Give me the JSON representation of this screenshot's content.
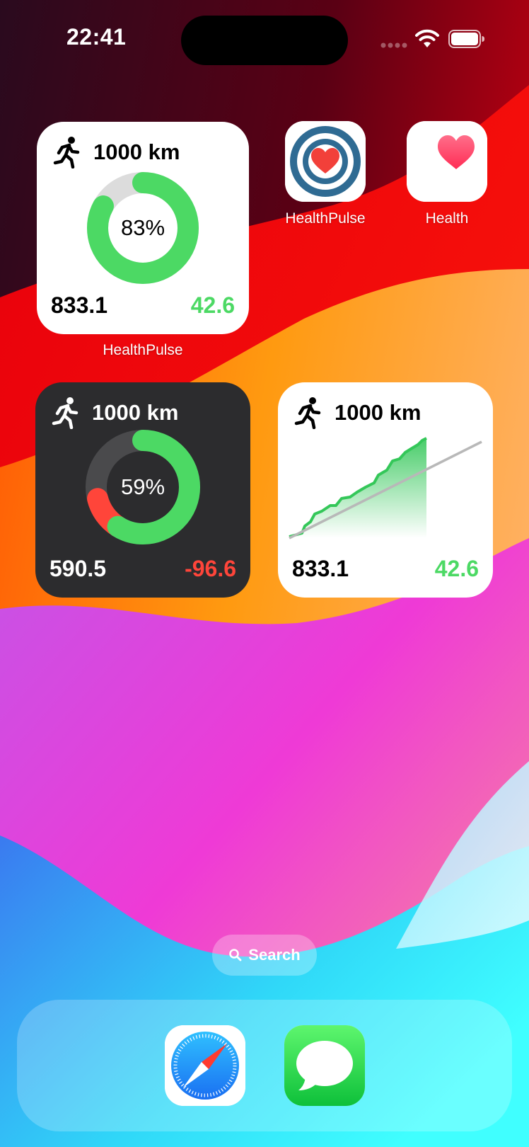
{
  "status_bar": {
    "time": "22:41"
  },
  "widgets": {
    "ring_light": {
      "title": "1000 km",
      "percent_label": "83%",
      "progress": 0.83,
      "left_value": "833.1",
      "right_value": "42.6"
    },
    "ring_dark": {
      "title": "1000 km",
      "percent_label": "59%",
      "progress": 0.59,
      "deficit": 0.12,
      "left_value": "590.5",
      "right_value": "-96.6"
    },
    "chart": {
      "title": "1000 km",
      "left_value": "833.1",
      "right_value": "42.6"
    }
  },
  "apps": {
    "widget_label": "HealthPulse",
    "healthpulse": {
      "label": "HealthPulse"
    },
    "health": {
      "label": "Health"
    }
  },
  "search": {
    "label": "Search"
  },
  "colors": {
    "green": "#4cd964",
    "red": "#ff453a",
    "dark_widget": "#2c2c2e"
  }
}
